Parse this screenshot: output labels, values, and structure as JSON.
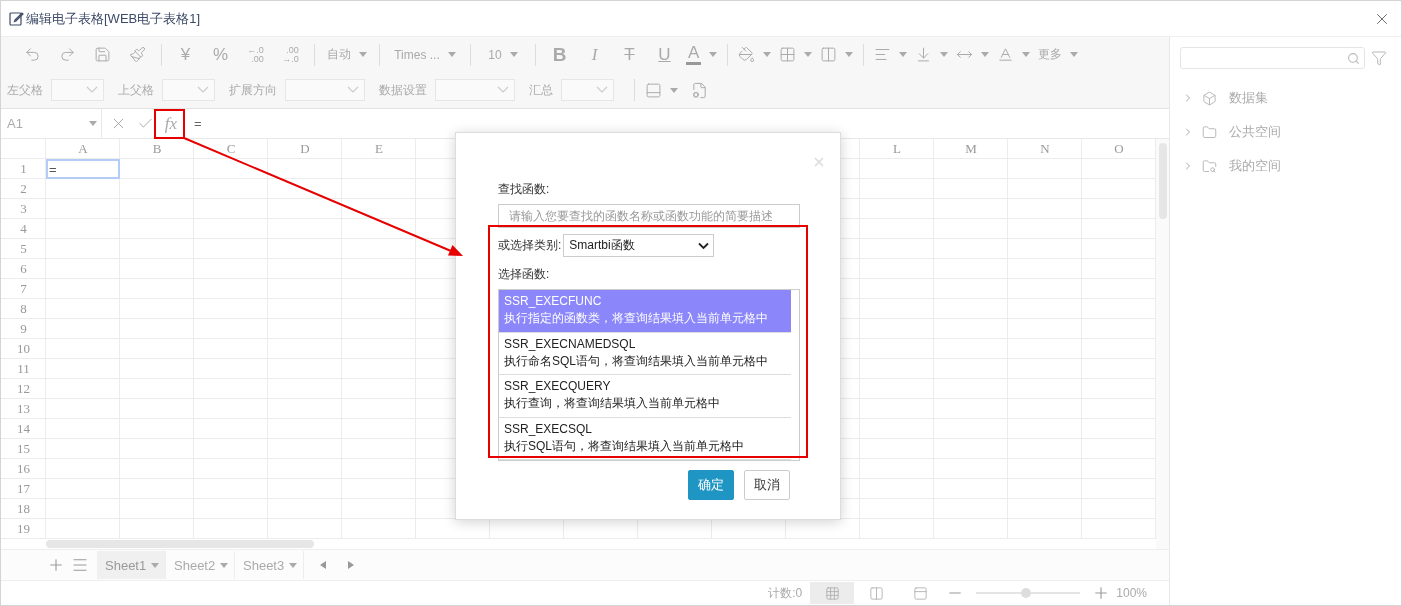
{
  "window": {
    "title": "编辑电子表格[WEB电子表格1]"
  },
  "toolbar": {
    "row_1": [
      [
        {
          "kind": "icon",
          "dropdown": false
        },
        {
          "kind": "icon",
          "dropdown": false
        },
        {
          "kind": "icon",
          "dropdown": false
        },
        {
          "kind": "icon",
          "dropdown": false
        }
      ],
      [
        {
          "kind": "symbol",
          "label": "¥",
          "dropdown": false
        },
        {
          "kind": "symbol",
          "label": "%",
          "dropdown": false
        },
        {
          "kind": "decimal",
          "top": "←.0",
          "bottom": ".00",
          "dropdown": false
        },
        {
          "kind": "decimal",
          "top": ".00",
          "bottom": "→.0",
          "dropdown": false
        }
      ],
      [
        {
          "kind": "select",
          "label": "自动",
          "dropdown": true
        }
      ],
      [
        {
          "kind": "select",
          "label": "Times ...",
          "dropdown": true
        }
      ],
      [
        {
          "kind": "select",
          "label": "10",
          "dropdown": true
        }
      ],
      [
        {
          "kind": "bold",
          "label": "B",
          "dropdown": false
        },
        {
          "kind": "italic",
          "label": "I",
          "dropdown": false
        },
        {
          "kind": "strike",
          "label": "T",
          "dropdown": false
        },
        {
          "kind": "underline",
          "label": "U",
          "dropdown": false
        },
        {
          "kind": "fontcolor",
          "label": "A",
          "dropdown": true
        }
      ],
      [
        {
          "kind": "icon",
          "dropdown": true
        },
        {
          "kind": "icon",
          "dropdown": true
        },
        {
          "kind": "icon",
          "dropdown": true
        }
      ],
      [
        {
          "kind": "icon",
          "dropdown": true
        },
        {
          "kind": "icon",
          "dropdown": true
        },
        {
          "kind": "icon",
          "dropdown": true
        },
        {
          "kind": "icon",
          "dropdown": true
        },
        {
          "kind": "text",
          "label": "更多",
          "dropdown": true
        }
      ]
    ],
    "row_2_fields": [
      {
        "label": "左父格"
      },
      {
        "label": "上父格"
      },
      {
        "label": "扩展方向"
      },
      {
        "label": "数据设置"
      },
      {
        "label": "汇总"
      }
    ],
    "row_2_icons": [
      {
        "dropdown": true
      },
      {
        "dropdown": false
      }
    ]
  },
  "formula_bar": {
    "cell_ref": "A1",
    "fx": "fx",
    "value": "="
  },
  "grid": {
    "columns_left": [
      "A",
      "B",
      "C",
      "D",
      "E"
    ],
    "columns_right": [
      "L",
      "M",
      "N",
      "O"
    ],
    "rows": [
      "1",
      "2",
      "3",
      "4",
      "5",
      "6",
      "7",
      "8",
      "9",
      "10",
      "11",
      "12",
      "13",
      "14",
      "15",
      "16",
      "17",
      "18",
      "19"
    ],
    "cell_a1": {
      "value": "=",
      "selected": true
    }
  },
  "sheets": {
    "tabs": [
      {
        "label": "Sheet1",
        "selected": true
      },
      {
        "label": "Sheet2",
        "selected": false
      },
      {
        "label": "Sheet3",
        "selected": false
      }
    ]
  },
  "status_bar": {
    "count": "计数:0",
    "views": [
      {
        "selected": true
      },
      {
        "selected": false
      },
      {
        "selected": false
      }
    ],
    "zoom": {
      "level": 0.48,
      "reading": "100%"
    }
  },
  "side_panel": {
    "tree": [
      {
        "label": "数据集",
        "expanded": false
      },
      {
        "label": "公共空间",
        "expanded": false
      },
      {
        "label": "我的空间",
        "expanded": false
      }
    ]
  },
  "dialog": {
    "search_label": "查找函数:",
    "search_placeholder": "请输入您要查找的函数名称或函数功能的简要描述",
    "category_label": "或选择类别:",
    "category_value": "Smartbi函数",
    "list_label": "选择函数:",
    "functions": [
      {
        "name": "SSR_EXECFUNC",
        "description": "执行指定的函数类，将查询结果填入当前单元格中",
        "selected": true
      },
      {
        "name": "SSR_EXECNAMEDSQL",
        "description": "执行命名SQL语句，将查询结果填入当前单元格中",
        "selected": false
      },
      {
        "name": "SSR_EXECQUERY",
        "description": "执行查询，将查询结果填入当前单元格中",
        "selected": false
      },
      {
        "name": "SSR_EXECSQL",
        "description": "执行SQL语句，将查询结果填入当前单元格中",
        "selected": false
      }
    ],
    "buttons": [
      {
        "label": "确定",
        "kind": "primary"
      },
      {
        "label": "取消",
        "kind": "secondary"
      }
    ]
  }
}
